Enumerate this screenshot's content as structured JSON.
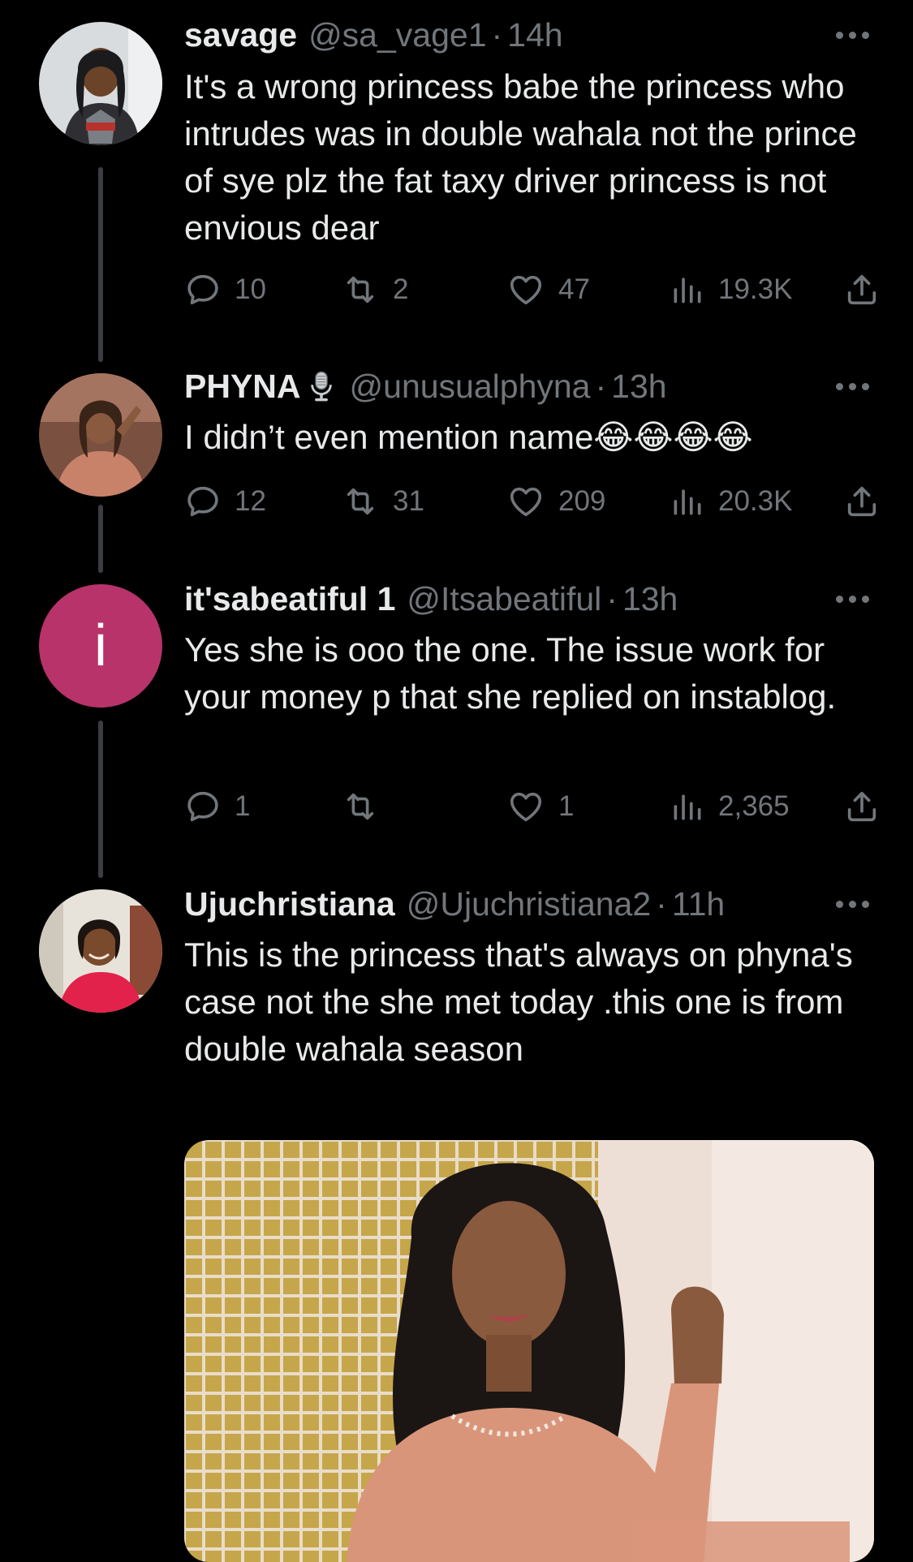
{
  "tweets": [
    {
      "name": "savage",
      "handle": "@sa_vage1",
      "separator": "·",
      "time": "14h",
      "text": "It's a wrong princess babe the princess who intrudes was in double wahala not the prince of sye plz the fat taxy driver princess is not envious dear",
      "replies": "10",
      "retweets": "2",
      "likes": "47",
      "views": "19.3K"
    },
    {
      "name": "PHYNA",
      "badge_icon": "microphone-icon",
      "handle": "@unusualphyna",
      "separator": "·",
      "time": "13h",
      "text": "I didn’t even mention name😂😂😂😂",
      "replies": "12",
      "retweets": "31",
      "likes": "209",
      "views": "20.3K"
    },
    {
      "name": "it'sabeatiful 1",
      "handle": "@Itsabeatiful",
      "separator": "·",
      "time": "13h",
      "avatar_letter": "i",
      "avatar_color": "#b8336a",
      "text": "Yes she is ooo the one. The issue work for your money p that she replied on instablog.",
      "replies": "1",
      "retweets": "",
      "likes": "1",
      "views": "2,365"
    },
    {
      "name": "Ujuchristiana",
      "handle": "@Ujuchristiana2",
      "separator": "·",
      "time": "11h",
      "text": "This is the princess that's always on phyna's case not the she met today .this one is from double wahala season"
    }
  ],
  "colors": {
    "background": "#000000",
    "text": "#e7e9ea",
    "muted": "#71767b",
    "thread_line": "#3a3d41"
  }
}
